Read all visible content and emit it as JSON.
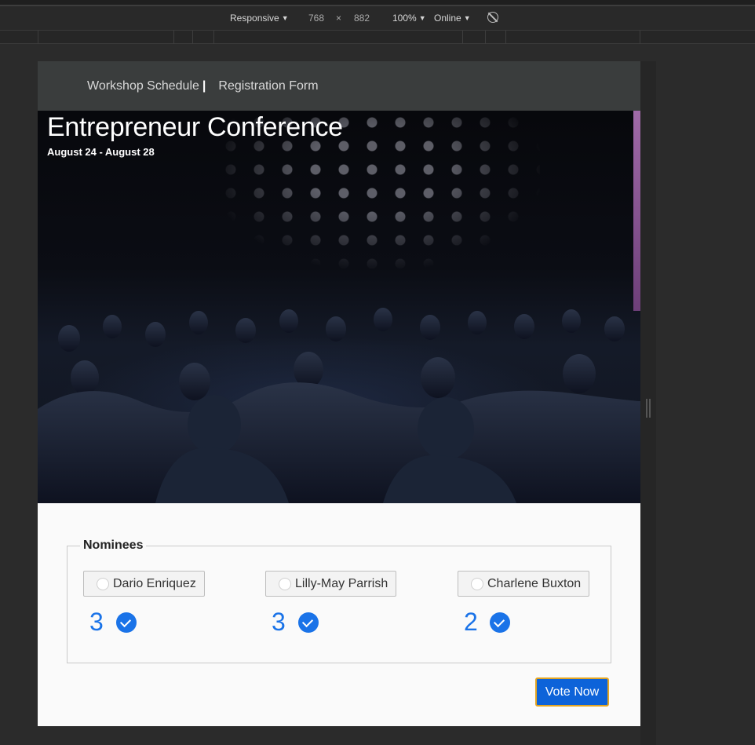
{
  "devtools": {
    "device": "Responsive",
    "width": "768",
    "times": "×",
    "height": "882",
    "zoom": "100%",
    "network": "Online"
  },
  "nav": {
    "schedule": "Workshop Schedule",
    "separator": "|",
    "registration": "Registration Form"
  },
  "hero": {
    "title": "Entrepreneur Conference",
    "dates": "August 24 - August 28"
  },
  "nominees": {
    "legend": "Nominees",
    "candidates": [
      {
        "name": "Dario Enriquez",
        "votes": "3"
      },
      {
        "name": "Lilly-May Parrish",
        "votes": "3"
      },
      {
        "name": "Charlene Buxton",
        "votes": "2"
      }
    ]
  },
  "vote_button": "Vote Now",
  "colors": {
    "accent": "#1a73e8",
    "button": "#0d63d9",
    "button_border": "#e3a522",
    "nav": "#3a3d3d"
  }
}
